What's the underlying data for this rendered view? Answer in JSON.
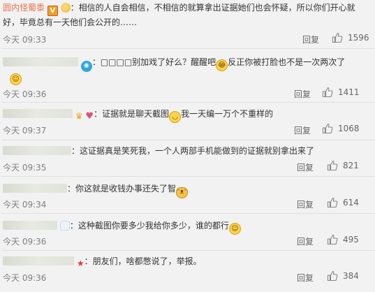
{
  "colors": {
    "background": "#f2f2f2",
    "username": "#eb7350",
    "time": "#808080",
    "action": "#666666"
  },
  "comments": [
    {
      "username": "圆内怪蜀黍",
      "content": "：相信的人自会相信，不相信的就算拿出证据她们也会怀疑，所以你们开心就好，毕竟总有一天他们会公开的……",
      "time": "今天 09:33",
      "reply": "回复",
      "likes": "1596",
      "icons": [
        "verified-v-icon",
        "grape-emoji-icon"
      ]
    },
    {
      "content": "：□□□□别加戏了好么？醒醒吧",
      "content_after": "反正你被打脸也不是一次两次了",
      "time": "今天 09:36",
      "reply": "回复",
      "likes": "1411",
      "icons": [
        "camera-badge-icon",
        "laugh-cry-emoji-icon",
        "smile-emoji-icon"
      ]
    },
    {
      "content": "：证据就是聊天截图",
      "content_after": "我一天编一万个不重样的",
      "time": "今天 09:37",
      "reply": "回复",
      "likes": "1068",
      "icons": [
        "crown-icon",
        "heart-icon",
        "smirk-emoji-icon"
      ]
    },
    {
      "content": "：这证据真是笑死我，一个人两部手机能做到的证据就别拿出来了",
      "time": "今天 09:35",
      "reply": "回复",
      "likes": "821"
    },
    {
      "content": "：你这就是收钱办事还失了智",
      "time": "今天 09:34",
      "reply": "回复",
      "likes": "614",
      "icons": [
        "cat-emoji-icon"
      ]
    },
    {
      "content": "：这种截图你要多少我给你多少，谁的都行",
      "time": "今天 09:36",
      "reply": "回复",
      "likes": "495",
      "icons": [
        "smile-emoji-icon"
      ]
    },
    {
      "content": "：朋友们，啥都憋说了，举报。",
      "time": "今天 09:36",
      "reply": "回复",
      "likes": "384",
      "icons": [
        "star-icon"
      ]
    }
  ]
}
